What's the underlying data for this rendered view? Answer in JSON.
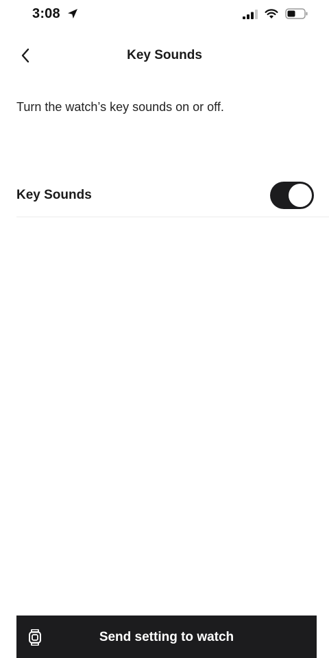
{
  "status_bar": {
    "time": "3:08",
    "icons": [
      "location-arrow-icon",
      "cellular-signal-icon",
      "wifi-icon",
      "battery-icon"
    ]
  },
  "nav": {
    "back_icon": "chevron-left-icon",
    "title": "Key Sounds"
  },
  "description": "Turn the watch’s key sounds on or off.",
  "setting": {
    "label": "Key Sounds",
    "enabled": true
  },
  "send_button": {
    "icon": "watch-icon",
    "label": "Send setting to watch"
  },
  "colors": {
    "accent": "#1c1c1e",
    "background": "#ffffff"
  }
}
